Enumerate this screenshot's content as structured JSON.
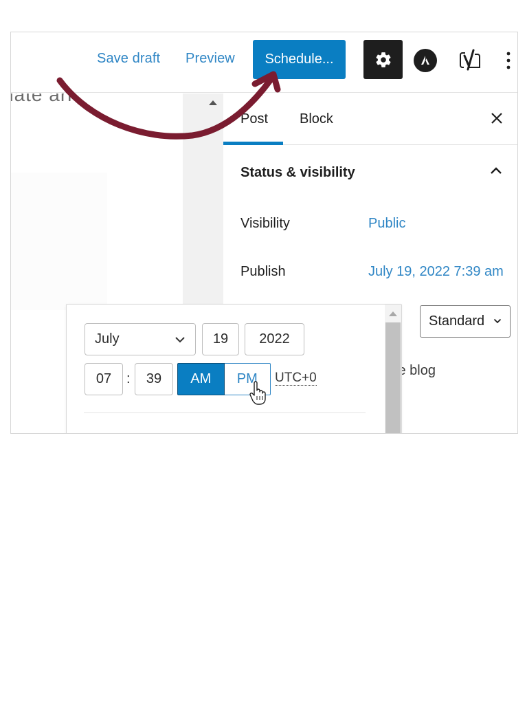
{
  "toolbar": {
    "save_draft_label": "Save draft",
    "preview_label": "Preview",
    "schedule_label": "Schedule...",
    "settings_icon": "gear-icon",
    "astra_icon": "astra-logo-icon",
    "yoast_icon": "yoast-logo-icon",
    "more_icon": "more-vertical-icon"
  },
  "canvas": {
    "partial_text": "date ari"
  },
  "sidebar": {
    "tabs": [
      {
        "label": "Post",
        "active": true
      },
      {
        "label": "Block",
        "active": false
      }
    ],
    "close_icon": "close-icon",
    "panel": {
      "title": "Status & visibility",
      "expanded": true,
      "rows": [
        {
          "label": "Visibility",
          "value": "Public"
        },
        {
          "label": "Publish",
          "value": "July 19, 2022 7:39 am"
        }
      ]
    },
    "post_format": {
      "selected": "Standard"
    },
    "partial_text": "ie blog"
  },
  "datetime_picker": {
    "month": "July",
    "day": "19",
    "year": "2022",
    "hour": "07",
    "separator": ":",
    "minute": "39",
    "am_label": "AM",
    "pm_label": "PM",
    "meridiem_selected": "AM",
    "timezone": "UTC+0"
  },
  "colors": {
    "primary": "#0a7ec2",
    "link": "#2f86c5",
    "dark": "#1e1e1e",
    "annotation_arrow": "#7a1c30"
  }
}
